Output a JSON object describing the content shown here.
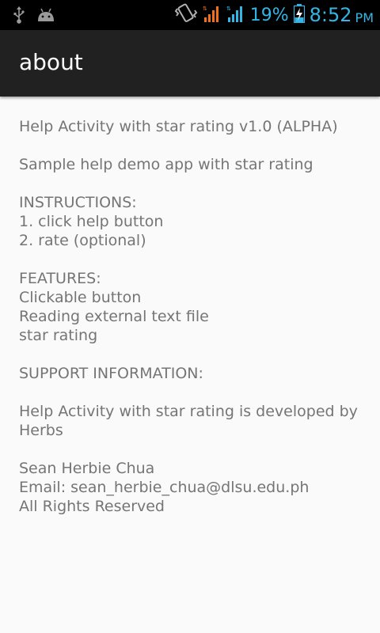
{
  "status_bar": {
    "battery_percent": "19%",
    "time": "8:52",
    "ampm": "PM",
    "accent_color": "#33b5e5",
    "signal_color_1": "#f0701e",
    "signal_color_2": "#33b5e5",
    "icons": [
      "usb-icon",
      "android-icon",
      "vibrate-icon",
      "signal-icon",
      "signal-icon",
      "battery-charging-icon"
    ]
  },
  "action_bar": {
    "title": "about",
    "background": "#212121"
  },
  "content": {
    "line_1": "Help Activity with star rating v1.0 (ALPHA)",
    "line_2": "Sample help demo app with star rating",
    "instructions_heading": "INSTRUCTIONS:",
    "instruction_1": "1. click help button",
    "instruction_2": "2. rate (optional)",
    "features_heading": "FEATURES:",
    "feature_1": "Clickable button",
    "feature_2": "Reading external text file",
    "feature_3": "star rating",
    "support_heading": "SUPPORT INFORMATION:",
    "support_text": "Help Activity with star rating is developed by Herbs",
    "author_name": "Sean Herbie Chua",
    "email": "Email: sean_herbie_chua@dlsu.edu.ph",
    "rights": "All Rights Reserved"
  }
}
